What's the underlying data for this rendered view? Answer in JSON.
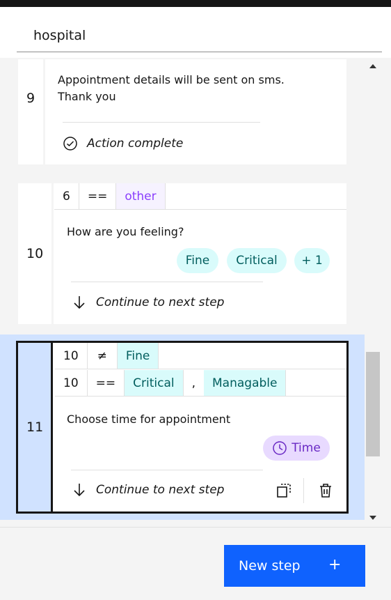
{
  "header": {
    "title": "hospital"
  },
  "steps": [
    {
      "number": "9",
      "message_line1": "Appointment details will be sent on sms.",
      "message_line2": "Thank you",
      "footer": "Action complete"
    },
    {
      "number": "10",
      "condition": {
        "left": "6",
        "op": "==",
        "value": "other"
      },
      "question": "How are you feeling?",
      "options": [
        "Fine",
        "Critical",
        "+ 1"
      ],
      "footer": "Continue to next step"
    },
    {
      "number": "11",
      "conditions": [
        {
          "left": "10",
          "op": "≠",
          "values": [
            "Fine"
          ]
        },
        {
          "left": "10",
          "op": "==",
          "values": [
            "Critical",
            "Managable"
          ],
          "separator": ","
        }
      ],
      "question": "Choose time for appointment",
      "response_type": "Time",
      "footer": "Continue to next step"
    }
  ],
  "new_step": {
    "label": "New step",
    "plus": "+"
  },
  "colors": {
    "primary": "#0f62fe",
    "selected_bg": "#d0e2ff",
    "teal_tag": "#d9fbfb",
    "purple_tag": "#e8daff"
  }
}
